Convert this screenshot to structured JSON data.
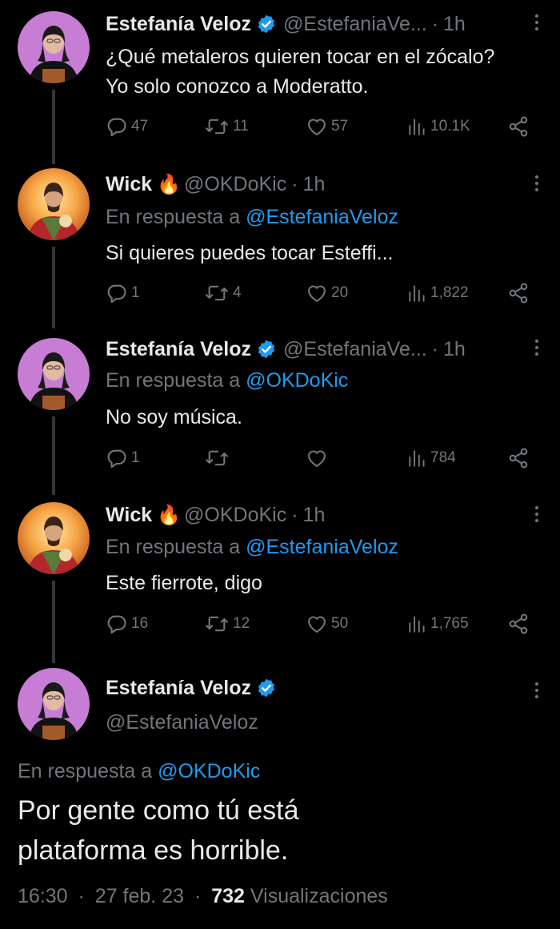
{
  "tweets": [
    {
      "name": "Estefanía Veloz",
      "handle": "@EstefaniaVe...",
      "time": "1h",
      "text": "¿Qué metaleros quieren tocar en el zócalo? Yo solo conozco a Moderatto.",
      "replies": "47",
      "retweets": "11",
      "likes": "57",
      "views": "10.1K"
    },
    {
      "name": "Wick",
      "handle": "@OKDoKic",
      "time": "1h",
      "reply_prefix": "En respuesta a",
      "reply_to": "@EstefaniaVeloz",
      "text": "Si quieres puedes tocar Esteffi...",
      "replies": "1",
      "retweets": "4",
      "likes": "20",
      "views": "1,822"
    },
    {
      "name": "Estefanía Veloz",
      "handle": "@EstefaniaVe...",
      "time": "1h",
      "reply_prefix": "En respuesta a",
      "reply_to": "@OKDoKic",
      "text": "No soy música.",
      "replies": "1",
      "retweets": "",
      "likes": "",
      "views": "784"
    },
    {
      "name": "Wick",
      "handle": "@OKDoKic",
      "time": "1h",
      "reply_prefix": "En respuesta a",
      "reply_to": "@EstefaniaVeloz",
      "text": "Este fierrote, digo",
      "replies": "16",
      "retweets": "12",
      "likes": "50",
      "views": "1,765"
    }
  ],
  "main": {
    "name": "Estefanía Veloz",
    "handle": "@EstefaniaVeloz",
    "reply_prefix": "En respuesta a",
    "reply_to": "@OKDoKic",
    "text": "Por gente como tú está plataforma es horrible.",
    "time": "16:30",
    "date": "27 feb. 23",
    "views_count": "732",
    "views_label": "Visualizaciones"
  },
  "separator": "·",
  "fire_emoji": "🔥",
  "colors": {
    "background": "#000000",
    "primary_text": "#e7e9ea",
    "secondary_text": "#71767b",
    "link": "#1d9bf0",
    "verified": "#1d9bf0",
    "thread_line": "#333639"
  },
  "icons": [
    "verified-badge-icon",
    "more-icon",
    "reply-icon",
    "retweet-icon",
    "like-icon",
    "views-icon",
    "share-icon"
  ]
}
